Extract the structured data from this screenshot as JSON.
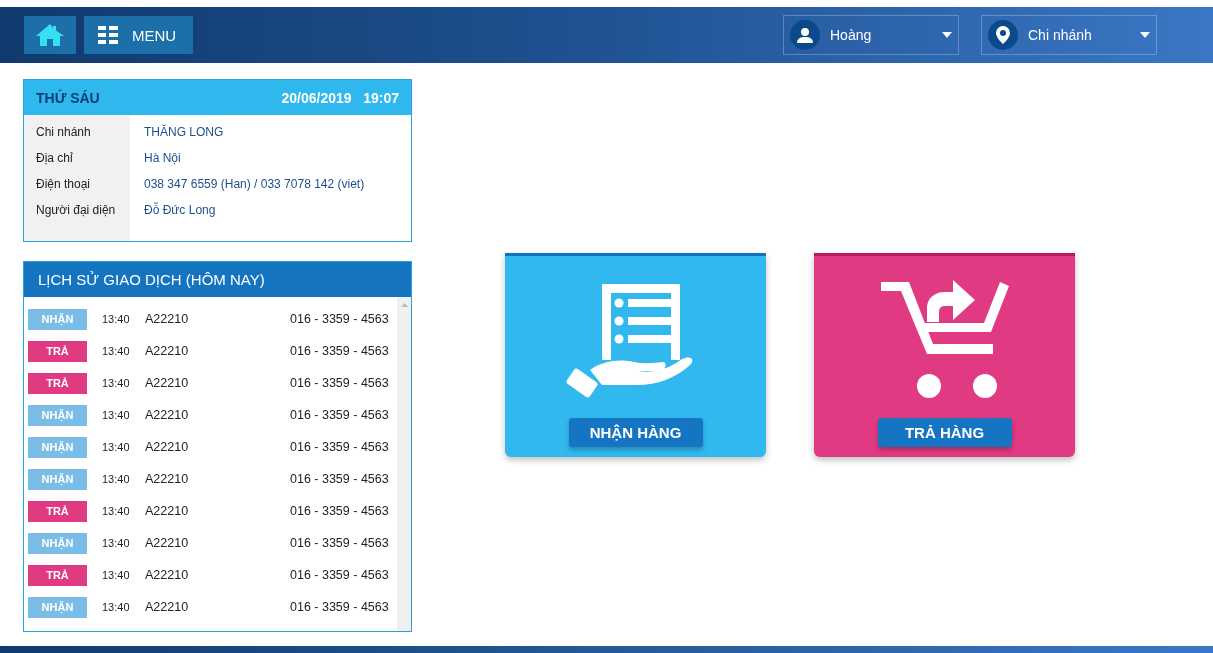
{
  "topbar": {
    "menu_label": "MENU",
    "user": "Hoàng",
    "branch": "Chi nhánh"
  },
  "info": {
    "day": "THỨ SÁU",
    "date": "20/06/2019",
    "time": "19:07",
    "rows": [
      {
        "label": "Chi nhánh",
        "value": "THĂNG LONG"
      },
      {
        "label": "Địa chỉ",
        "value": "Hà Nội"
      },
      {
        "label": "Điện thoại",
        "value": "038 347 6559 (Han) / 033 7078 142 (viet)"
      },
      {
        "label": "Người đại diện",
        "value": "Đỗ Đức Long"
      }
    ]
  },
  "history": {
    "title": "LỊCH SỬ GIAO DỊCH (HÔM NAY)",
    "rows": [
      {
        "kind": "nhan",
        "tag": "NHẬN",
        "time": "13:40",
        "code": "A22210",
        "phone": "016 - 3359 - 4563"
      },
      {
        "kind": "tra",
        "tag": "TRẢ",
        "time": "13:40",
        "code": "A22210",
        "phone": "016 - 3359 - 4563"
      },
      {
        "kind": "tra",
        "tag": "TRẢ",
        "time": "13:40",
        "code": "A22210",
        "phone": "016 - 3359 - 4563"
      },
      {
        "kind": "nhan",
        "tag": "NHẬN",
        "time": "13:40",
        "code": "A22210",
        "phone": "016 - 3359 - 4563"
      },
      {
        "kind": "nhan",
        "tag": "NHẬN",
        "time": "13:40",
        "code": "A22210",
        "phone": "016 - 3359 - 4563"
      },
      {
        "kind": "nhan",
        "tag": "NHẬN",
        "time": "13:40",
        "code": "A22210",
        "phone": "016 - 3359 - 4563"
      },
      {
        "kind": "tra",
        "tag": "TRẢ",
        "time": "13:40",
        "code": "A22210",
        "phone": "016 - 3359 - 4563"
      },
      {
        "kind": "nhan",
        "tag": "NHẬN",
        "time": "13:40",
        "code": "A22210",
        "phone": "016 - 3359 - 4563"
      },
      {
        "kind": "tra",
        "tag": "TRẢ",
        "time": "13:40",
        "code": "A22210",
        "phone": "016 - 3359 - 4563"
      },
      {
        "kind": "nhan",
        "tag": "NHẬN",
        "time": "13:40",
        "code": "A22210",
        "phone": "016 - 3359 - 4563"
      }
    ]
  },
  "actions": [
    {
      "kind": "receive",
      "label": "NHẬN HÀNG"
    },
    {
      "kind": "return",
      "label": "TRẢ HÀNG"
    }
  ]
}
